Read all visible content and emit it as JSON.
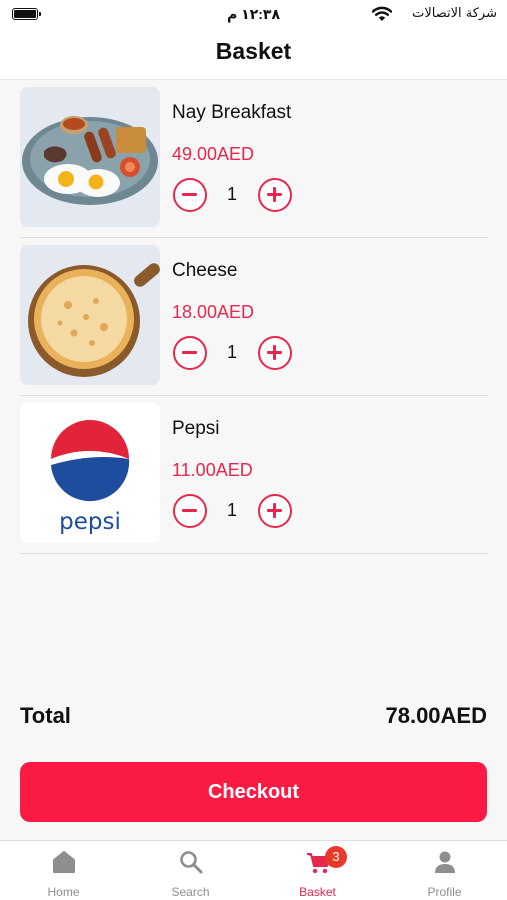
{
  "status_bar": {
    "time": "١٢:٣٨ م",
    "carrier": "شركة الاتصالات",
    "battery_level": 1.0
  },
  "header": {
    "title": "Basket"
  },
  "items": [
    {
      "name": "Nay Breakfast",
      "price": "49.00AED",
      "quantity": "1",
      "image": "breakfast-plate"
    },
    {
      "name": "Cheese",
      "price": "18.00AED",
      "quantity": "1",
      "image": "cheese-pizza"
    },
    {
      "name": "Pepsi",
      "price": "11.00AED",
      "quantity": "1",
      "image": "pepsi-logo",
      "logo_text": "pepsi"
    }
  ],
  "summary": {
    "total_label": "Total",
    "total_value": "78.00AED"
  },
  "checkout": {
    "label": "Checkout"
  },
  "tab_bar": {
    "tabs": [
      {
        "label": "Home",
        "icon": "home-icon"
      },
      {
        "label": "Search",
        "icon": "search-icon"
      },
      {
        "label": "Basket",
        "icon": "cart-icon",
        "badge": "3",
        "active": true
      },
      {
        "label": "Profile",
        "icon": "person-icon"
      }
    ]
  },
  "colors": {
    "accent": "#e8274c",
    "checkout_button": "#fb1a44",
    "badge": "#e8392a",
    "inactive_tab": "#8e8e8e",
    "background": "#f7f7f7"
  }
}
